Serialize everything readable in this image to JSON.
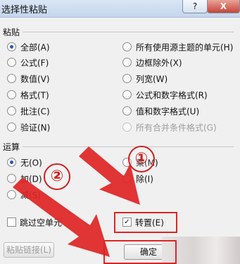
{
  "window": {
    "title": "选择性粘贴",
    "help_label": "?",
    "close_label": "X"
  },
  "paste": {
    "section_label": "粘贴",
    "options_left": [
      {
        "label": "全部(A)",
        "selected": true
      },
      {
        "label": "公式(F)",
        "selected": false
      },
      {
        "label": "数值(V)",
        "selected": false
      },
      {
        "label": "格式(T)",
        "selected": false
      },
      {
        "label": "批注(C)",
        "selected": false
      },
      {
        "label": "验证(N)",
        "selected": false
      }
    ],
    "options_right": [
      {
        "label": "所有使用源主题的单元(H)",
        "selected": false,
        "enabled": true
      },
      {
        "label": "边框除外(X)",
        "selected": false,
        "enabled": true
      },
      {
        "label": "列宽(W)",
        "selected": false,
        "enabled": true
      },
      {
        "label": "公式和数字格式(R)",
        "selected": false,
        "enabled": true
      },
      {
        "label": "值和数字格式(U)",
        "selected": false,
        "enabled": true
      },
      {
        "label": "所有合并条件格式(G)",
        "selected": false,
        "enabled": false
      }
    ]
  },
  "operation": {
    "section_label": "运算",
    "options_left": [
      {
        "label": "无(O)",
        "selected": true
      },
      {
        "label": "加(D)",
        "selected": false
      },
      {
        "label": "减(S)",
        "selected": false
      }
    ],
    "options_right": [
      {
        "label": "乘(M)",
        "selected": false
      },
      {
        "label": "除(I)",
        "selected": false
      }
    ]
  },
  "checkboxes": {
    "skip_blanks": {
      "label": "跳过空单元",
      "checked": false
    },
    "transpose": {
      "label": "转置(E)",
      "checked": true,
      "mark": "✓"
    }
  },
  "buttons": {
    "paste_link": "粘贴链接(L)",
    "ok": "确定"
  },
  "annotations": {
    "callout_1": "①",
    "callout_2": "②",
    "color": "#e02424"
  }
}
